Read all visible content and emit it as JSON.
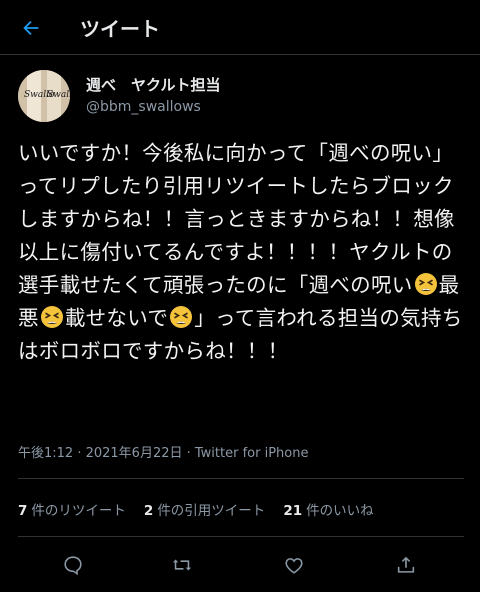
{
  "header": {
    "title": "ツイート",
    "back_icon": "arrow-left-icon"
  },
  "colors": {
    "accent": "#1d9bf0",
    "background": "#000000",
    "secondary_text": "#8b98a5"
  },
  "author": {
    "display_name": "週べ　ヤクルト担当",
    "handle": "@bbm_swallows",
    "avatar_icon": "baseball-bat-swallows-avatar",
    "avatar_text_left": "Swallo",
    "avatar_text_right": "Swallo"
  },
  "tweet": {
    "segment1": "いいですか！今後私に向かって「週べの呪い」ってリプしたり引用リツイートしたらブロックしますからね！！言っときますからね！！想像以上に傷付いてるんですよ！！！！ヤクルトの選手載せたくて頑張ったのに「週べの呪い",
    "segment2": "最悪",
    "segment3": "載せないで",
    "segment4": "」って言われる担当の気持ちはボロボロですからね！！！",
    "emoji_icon": "tired-face-emoji"
  },
  "meta": {
    "time": "午後1:12 · 2021年6月22日 · ",
    "source": "Twitter for iPhone"
  },
  "stats": {
    "retweets_count": "7",
    "retweets_label": "件のリツイート",
    "quotes_count": "2",
    "quotes_label": "件の引用ツイート",
    "likes_count": "21",
    "likes_label": "件のいいね"
  },
  "actions": {
    "reply_icon": "reply-icon",
    "retweet_icon": "retweet-icon",
    "like_icon": "heart-icon",
    "share_icon": "share-icon"
  }
}
